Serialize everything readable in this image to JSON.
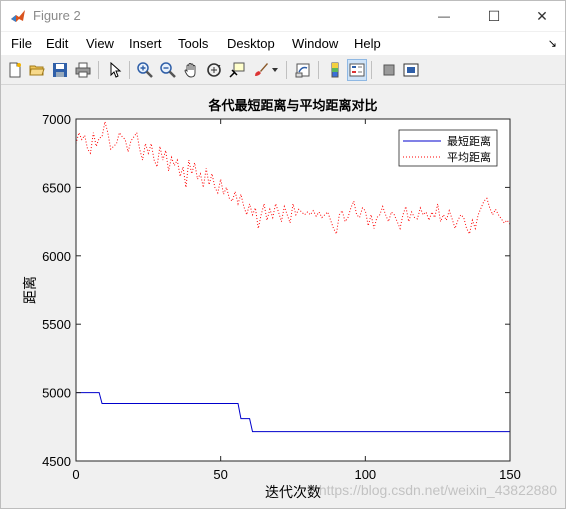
{
  "window": {
    "title": "Figure 2",
    "controls": {
      "minimize": "—",
      "maximize": "☐",
      "close": "✕"
    }
  },
  "menu": {
    "items": [
      "File",
      "Edit",
      "View",
      "Insert",
      "Tools",
      "Desktop",
      "Window",
      "Help"
    ],
    "overflow_arrow": "↘"
  },
  "toolbar": {
    "icons": [
      "new-figure-icon",
      "open-file-icon",
      "save-icon",
      "print-icon",
      "edit-plot-icon",
      "zoom-in-icon",
      "zoom-out-icon",
      "pan-icon",
      "rotate-3d-icon",
      "data-cursor-icon",
      "brush-icon",
      "link-plot-icon",
      "colorbar-icon",
      "legend-icon",
      "hide-plot-tools-icon",
      "show-plot-tools-icon"
    ]
  },
  "watermark": "https://blog.csdn.net/weixin_43822880",
  "colors": {
    "min_series": "#0000cc",
    "avg_series": "#ff0000",
    "axes_bg": "#ffffff",
    "figure_bg": "#f0f0f0"
  },
  "chart_data": {
    "type": "line",
    "title": "各代最短距离与平均距离对比",
    "xlabel": "迭代次数",
    "ylabel": "距离",
    "xlim": [
      0,
      150
    ],
    "ylim": [
      4500,
      7000
    ],
    "xticks": [
      0,
      50,
      100,
      150
    ],
    "yticks": [
      4500,
      5000,
      5500,
      6000,
      6500,
      7000
    ],
    "grid": false,
    "legend_position": "top-right",
    "series": [
      {
        "name": "最短距离",
        "style": "solid",
        "color": "#0000cc",
        "x": [
          0,
          8,
          9,
          56,
          57,
          60,
          61,
          150
        ],
        "y": [
          5000,
          5000,
          4920,
          4920,
          4810,
          4810,
          4715,
          4715
        ]
      },
      {
        "name": "平均距离",
        "style": "dotted",
        "color": "#ff0000",
        "x": [
          0,
          1,
          2,
          3,
          4,
          5,
          6,
          7,
          8,
          9,
          10,
          11,
          12,
          13,
          14,
          15,
          16,
          17,
          18,
          19,
          20,
          21,
          22,
          23,
          24,
          25,
          26,
          27,
          28,
          29,
          30,
          31,
          32,
          33,
          34,
          35,
          36,
          37,
          38,
          39,
          40,
          41,
          42,
          43,
          44,
          45,
          46,
          47,
          48,
          49,
          50,
          51,
          52,
          53,
          54,
          55,
          56,
          57,
          58,
          59,
          60,
          61,
          62,
          63,
          64,
          65,
          66,
          67,
          68,
          69,
          70,
          71,
          72,
          73,
          74,
          75,
          76,
          77,
          78,
          79,
          80,
          81,
          82,
          83,
          84,
          85,
          86,
          87,
          88,
          89,
          90,
          91,
          92,
          93,
          94,
          95,
          96,
          97,
          98,
          99,
          100,
          101,
          102,
          103,
          104,
          105,
          106,
          107,
          108,
          109,
          110,
          111,
          112,
          113,
          114,
          115,
          116,
          117,
          118,
          119,
          120,
          121,
          122,
          123,
          124,
          125,
          126,
          127,
          128,
          129,
          130,
          131,
          132,
          133,
          134,
          135,
          136,
          137,
          138,
          139,
          140,
          141,
          142,
          143,
          144,
          145,
          146,
          147,
          148,
          149,
          150
        ],
        "y": [
          6820,
          6900,
          6850,
          6880,
          6780,
          6750,
          6900,
          6800,
          6860,
          6870,
          6980,
          6900,
          6780,
          6800,
          6820,
          6900,
          6870,
          6850,
          6760,
          6840,
          6870,
          6900,
          6780,
          6700,
          6820,
          6750,
          6820,
          6700,
          6650,
          6800,
          6700,
          6770,
          6620,
          6720,
          6660,
          6700,
          6580,
          6650,
          6500,
          6700,
          6600,
          6680,
          6560,
          6600,
          6500,
          6640,
          6520,
          6600,
          6500,
          6460,
          6560,
          6450,
          6500,
          6420,
          6400,
          6470,
          6380,
          6450,
          6360,
          6300,
          6380,
          6300,
          6350,
          6200,
          6300,
          6380,
          6260,
          6340,
          6280,
          6380,
          6320,
          6250,
          6360,
          6300,
          6240,
          6380,
          6300,
          6340,
          6320,
          6300,
          6320,
          6300,
          6330,
          6290,
          6320,
          6280,
          6300,
          6320,
          6260,
          6200,
          6160,
          6300,
          6330,
          6250,
          6280,
          6350,
          6400,
          6300,
          6280,
          6350,
          6330,
          6220,
          6300,
          6200,
          6280,
          6300,
          6360,
          6300,
          6250,
          6320,
          6300,
          6250,
          6200,
          6300,
          6360,
          6250,
          6320,
          6280,
          6270,
          6350,
          6300,
          6320,
          6260,
          6320,
          6280,
          6380,
          6250,
          6300,
          6260,
          6330,
          6270,
          6200,
          6260,
          6300,
          6280,
          6200,
          6160,
          6260,
          6200,
          6300,
          6350,
          6400,
          6420,
          6350,
          6300,
          6340,
          6300,
          6270,
          6240,
          6260,
          6230
        ]
      }
    ]
  }
}
